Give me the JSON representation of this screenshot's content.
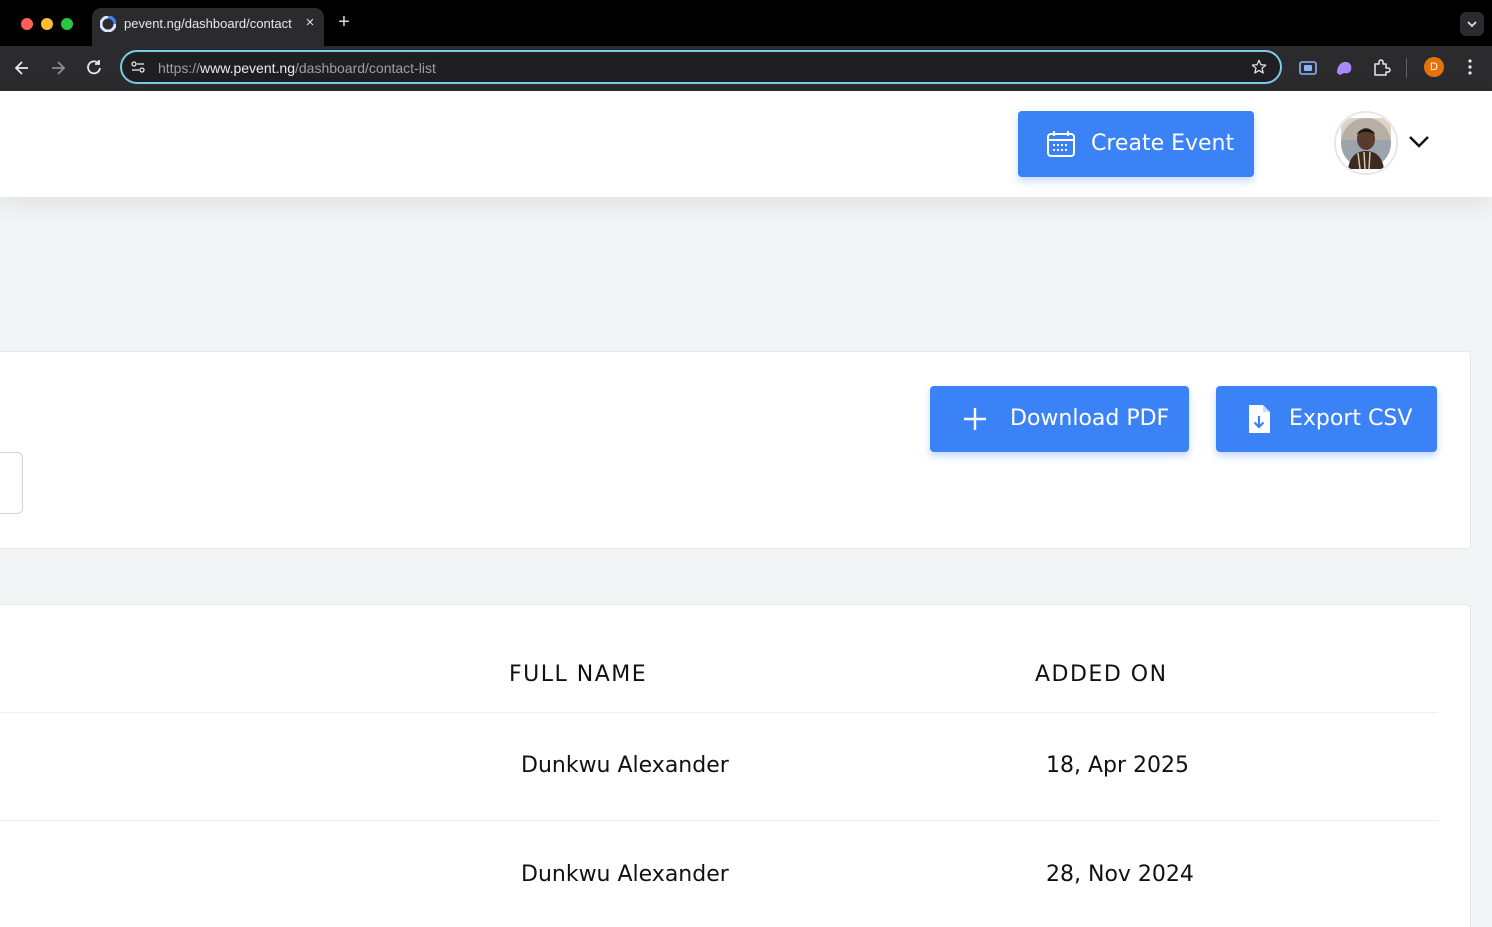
{
  "browser": {
    "tab_title": "pevent.ng/dashboard/contact",
    "new_tab_symbol": "+",
    "close_symbol": "×",
    "url_scheme": "https://",
    "url_host": "www.pevent.ng",
    "url_path": "/dashboard/contact-list",
    "profile_initial": "D"
  },
  "header": {
    "create_event_label": "Create Event"
  },
  "actions": {
    "download_pdf_label": "Download PDF",
    "export_csv_label": "Export CSV"
  },
  "table": {
    "columns": [
      "FULL NAME",
      "ADDED ON"
    ],
    "rows": [
      {
        "full_name": "Dunkwu Alexander",
        "added_on": "18, Apr 2025"
      },
      {
        "full_name": "Dunkwu Alexander",
        "added_on": "28, Nov 2024"
      }
    ]
  },
  "colors": {
    "primary": "#3b82f6",
    "omnibox_focus": "#7cc9e8",
    "profile_badge": "#e8710a"
  }
}
